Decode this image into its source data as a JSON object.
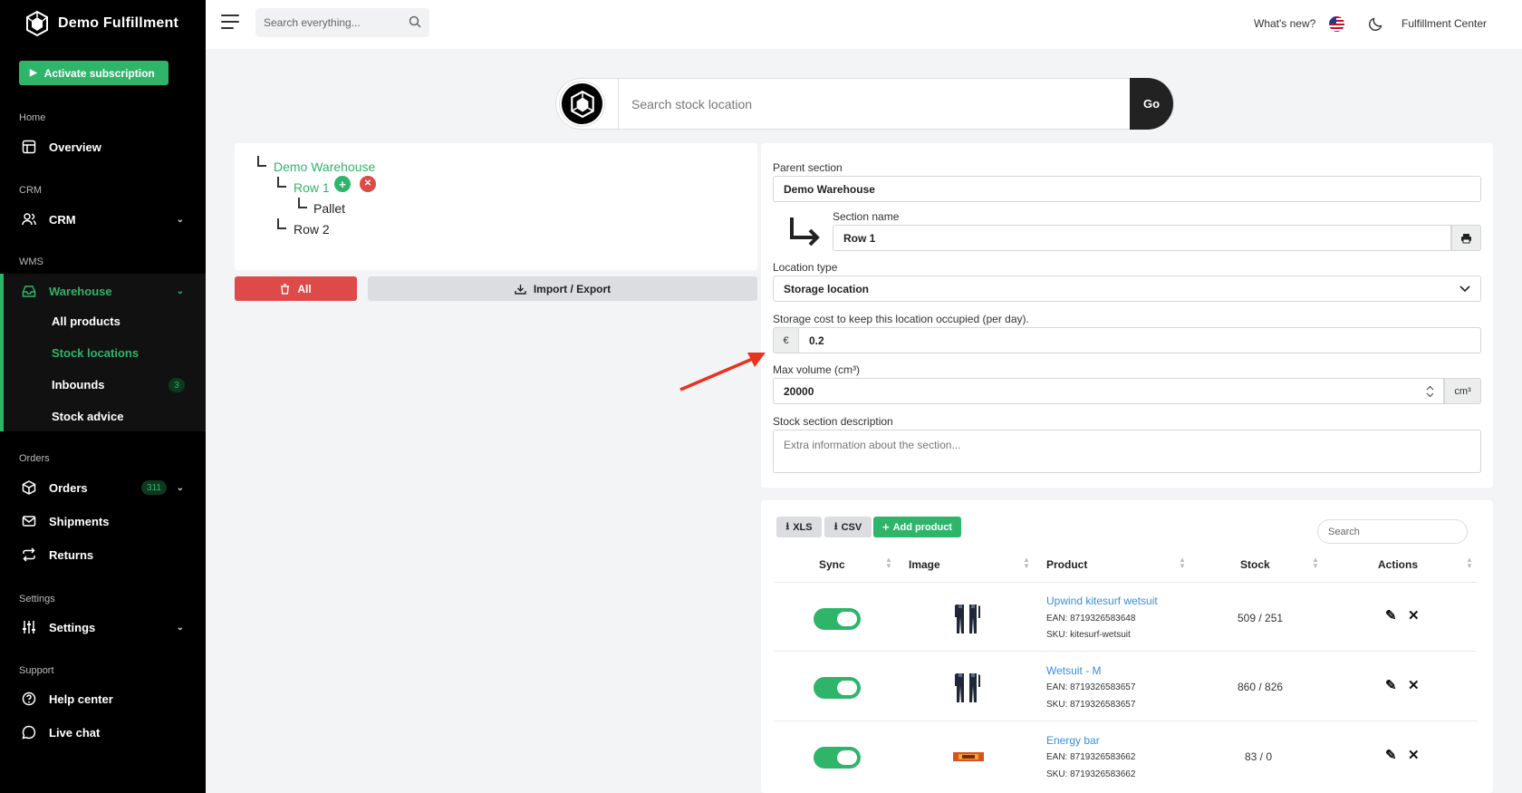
{
  "app": {
    "brand": "Demo Fulfillment",
    "activate_label": "Activate subscription"
  },
  "sidebar": {
    "sections": {
      "home": "Home",
      "crm": "CRM",
      "wms": "WMS",
      "orders": "Orders",
      "settings": "Settings",
      "support": "Support"
    },
    "items": {
      "overview": "Overview",
      "crm": "CRM",
      "warehouse": "Warehouse",
      "all_products": "All products",
      "stock_locations": "Stock locations",
      "inbounds": "Inbounds",
      "inbounds_badge": "3",
      "stock_advice": "Stock advice",
      "orders": "Orders",
      "orders_badge": "311",
      "shipments": "Shipments",
      "returns": "Returns",
      "settings": "Settings",
      "help_center": "Help center",
      "live_chat": "Live chat"
    }
  },
  "topbar": {
    "search_placeholder": "Search everything...",
    "whats_new": "What's new?",
    "account": "Fulfillment Center"
  },
  "location_search": {
    "placeholder": "Search stock location",
    "go_label": "Go"
  },
  "tree": {
    "root": "Demo Warehouse",
    "row1": "Row 1",
    "pallet": "Pallet",
    "row2": "Row 2"
  },
  "tree_actions": {
    "all_label": "All",
    "import_export_label": "Import / Export"
  },
  "form": {
    "parent_section_label": "Parent section",
    "parent_section_value": "Demo Warehouse",
    "section_name_label": "Section name",
    "section_name_value": "Row 1",
    "location_type_label": "Location type",
    "location_type_value": "Storage location",
    "storage_cost_label": "Storage cost to keep this location occupied (per day).",
    "currency": "€",
    "storage_cost_value": "0.2",
    "max_volume_label": "Max volume (cm³)",
    "max_volume_value": "20000",
    "volume_unit": "cm³",
    "description_label": "Stock section description",
    "description_placeholder": "Extra information about the section..."
  },
  "table": {
    "xls_label": "XLS",
    "csv_label": "CSV",
    "add_product_label": "Add product",
    "search_placeholder": "Search",
    "headers": {
      "sync": "Sync",
      "image": "Image",
      "product": "Product",
      "stock": "Stock",
      "actions": "Actions"
    },
    "rows": [
      {
        "name": "Upwind kitesurf wetsuit",
        "ean": "EAN: 8719326583648",
        "sku": "SKU: kitesurf-wetsuit",
        "stock": "509 / 251",
        "synced": true,
        "image": "wetsuit"
      },
      {
        "name": "Wetsuit - M",
        "ean": "EAN: 8719326583657",
        "sku": "SKU: 8719326583657",
        "stock": "860 / 826",
        "synced": true,
        "image": "wetsuit"
      },
      {
        "name": "Energy bar",
        "ean": "EAN: 8719326583662",
        "sku": "SKU: 8719326583662",
        "stock": "83 / 0",
        "synced": true,
        "image": "energy-bar"
      }
    ]
  },
  "colors": {
    "accent": "#2fb56a",
    "danger": "#dd4a48",
    "sidebar_bg": "#000000",
    "link": "#3a8de0"
  }
}
